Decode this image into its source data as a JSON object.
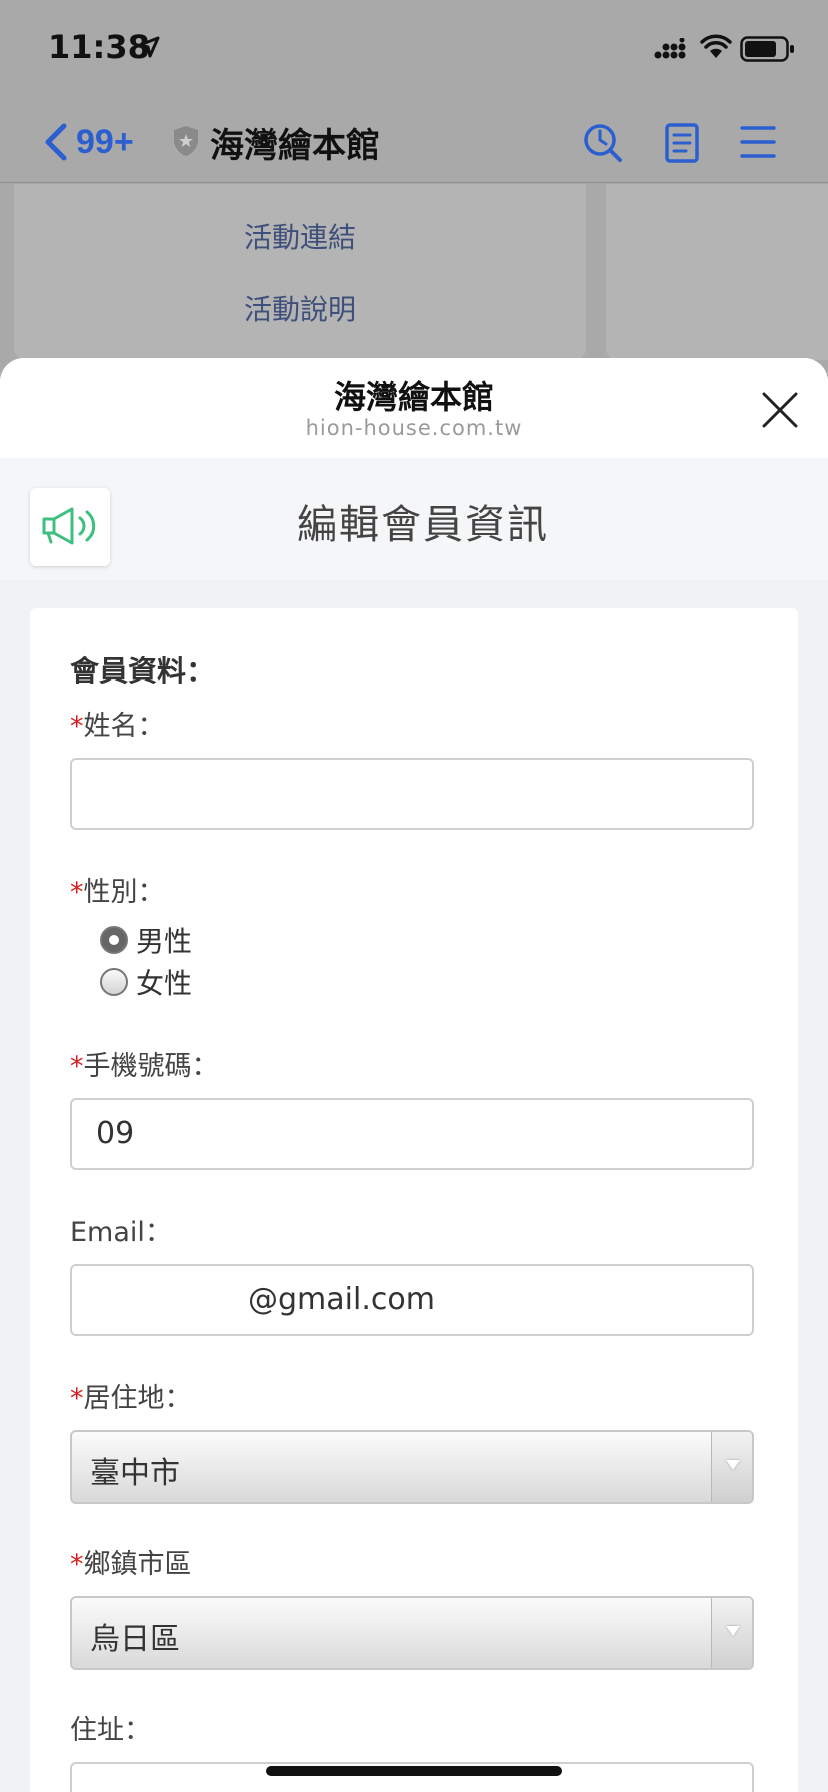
{
  "status_bar": {
    "time": "11:38"
  },
  "nav": {
    "back_count": "99+",
    "title": "海灣繪本館"
  },
  "background_page": {
    "links": [
      "活動連結",
      "活動說明"
    ]
  },
  "sheet": {
    "title": "海灣繪本館",
    "url": "hion-house.com.tw"
  },
  "page": {
    "title": "編輯會員資訊"
  },
  "form": {
    "section_title": "會員資料：",
    "required_mark": "*",
    "name": {
      "label": "姓名：",
      "value": ""
    },
    "gender": {
      "label": "性別：",
      "options": [
        "男性",
        "女性"
      ],
      "selected": "男性"
    },
    "phone": {
      "label": "手機號碼：",
      "value": "09"
    },
    "email": {
      "label": "Email：",
      "value": "@gmail.com"
    },
    "city": {
      "label": "居住地：",
      "value": "臺中市"
    },
    "district": {
      "label": "鄉鎮市區",
      "value": "烏日區"
    },
    "address": {
      "label": "住址："
    }
  },
  "colors": {
    "accent": "#2b5fcf",
    "required": "#d81f1f",
    "megaphone": "#3fbf7f"
  },
  "icons": [
    "location-arrow-icon",
    "signal-icon",
    "wifi-icon",
    "battery-icon",
    "back-chevron-icon",
    "shield-icon",
    "search-icon",
    "document-icon",
    "menu-icon",
    "close-icon",
    "megaphone-icon"
  ]
}
